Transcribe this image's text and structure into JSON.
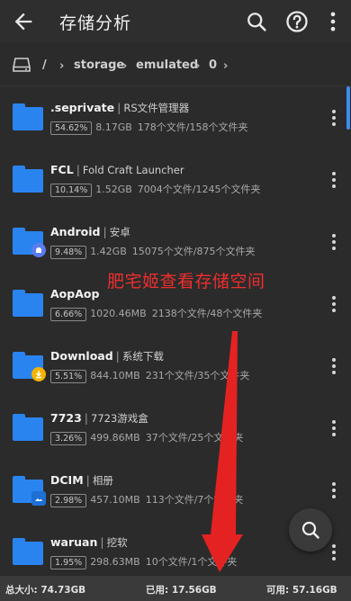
{
  "appbar": {
    "title": "存储分析",
    "icons": [
      "back-arrow-icon",
      "search-icon",
      "help-icon",
      "more-vert-icon"
    ]
  },
  "breadcrumb": {
    "root": "/",
    "parts": [
      "storage",
      "emulated",
      "0"
    ]
  },
  "items": [
    {
      "name": ".seprivate",
      "alias": "RS文件管理器",
      "pct": "54.62%",
      "size": "8.17GB",
      "counts": "178个文件/158个文件夹",
      "badge": ""
    },
    {
      "name": "FCL",
      "alias": "Fold Craft Launcher",
      "pct": "10.14%",
      "size": "1.52GB",
      "counts": "7004个文件/1245个文件夹",
      "badge": ""
    },
    {
      "name": "Android",
      "alias": "安卓",
      "pct": "9.48%",
      "size": "1.42GB",
      "counts": "15075个文件/875个文件夹",
      "badge": "android-badge-icon"
    },
    {
      "name": "AopAop",
      "alias": "",
      "pct": "6.66%",
      "size": "1020.46MB",
      "counts": "2138个文件/48个文件夹",
      "badge": ""
    },
    {
      "name": "Download",
      "alias": "系统下载",
      "pct": "5.51%",
      "size": "844.10MB",
      "counts": "231个文件/35个文件夹",
      "badge": "download-badge-icon"
    },
    {
      "name": "7723",
      "alias": "7723游戏盒",
      "pct": "3.26%",
      "size": "499.86MB",
      "counts": "37个文件/25个文件夹",
      "badge": ""
    },
    {
      "name": "DCIM",
      "alias": "相册",
      "pct": "2.98%",
      "size": "457.10MB",
      "counts": "113个文件/7个文件夹",
      "badge": "image-badge-icon"
    },
    {
      "name": "waruan",
      "alias": "挖软",
      "pct": "1.95%",
      "size": "298.63MB",
      "counts": "10个文件/1个文件夹",
      "badge": ""
    }
  ],
  "overlay_caption": "肥宅姬查看存储空间",
  "footer": {
    "total": "总大小: 74.73GB",
    "used": "已用: 17.56GB",
    "available": "可用: 57.16GB"
  },
  "colors": {
    "folder": "#2a84f0",
    "accent": "#3d8df0",
    "caption": "#ee2e2e",
    "arrow": "#e52222"
  }
}
